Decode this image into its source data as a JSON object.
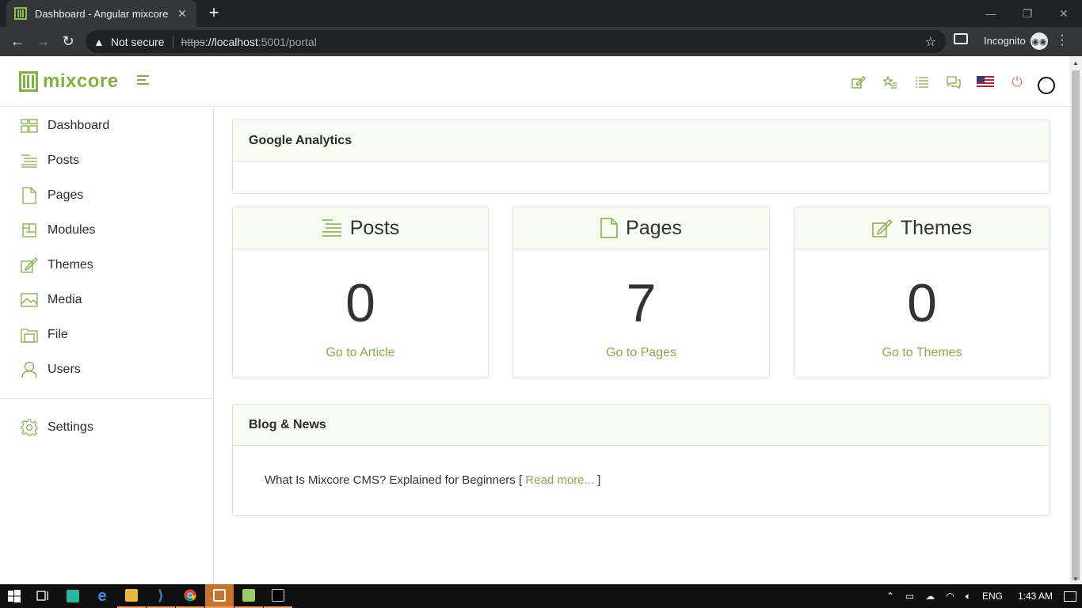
{
  "browser": {
    "tab_title": "Dashboard - Angular mixcore",
    "tab_close": "✕",
    "new_tab": "+",
    "security_label": "Not secure",
    "url_scheme": "https",
    "url_host": "://localhost",
    "url_path": ":5001/portal",
    "profile_label": "Incognito"
  },
  "header": {
    "logo_text": "mixcore",
    "icons": [
      "edit-icon",
      "star-list-icon",
      "list-icon",
      "messages-icon",
      "us-flag-icon",
      "power-icon",
      "user-avatar-icon"
    ]
  },
  "sidebar": {
    "items": [
      {
        "label": "Dashboard",
        "icon": "dashboard-icon"
      },
      {
        "label": "Posts",
        "icon": "posts-icon"
      },
      {
        "label": "Pages",
        "icon": "pages-icon"
      },
      {
        "label": "Modules",
        "icon": "modules-icon"
      },
      {
        "label": "Themes",
        "icon": "themes-icon"
      },
      {
        "label": "Media",
        "icon": "media-icon"
      },
      {
        "label": "File",
        "icon": "file-icon"
      },
      {
        "label": "Users",
        "icon": "users-icon"
      }
    ],
    "settings_label": "Settings"
  },
  "main": {
    "analytics_title": "Google Analytics",
    "cards": [
      {
        "title": "Posts",
        "count": "0",
        "link": "Go to Article"
      },
      {
        "title": "Pages",
        "count": "7",
        "link": "Go to Pages"
      },
      {
        "title": "Themes",
        "count": "0",
        "link": "Go to Themes"
      }
    ],
    "news": {
      "title": "Blog & News",
      "item_text": "What Is Mixcore CMS? Explained for Beginners [ ",
      "item_link": "Read more...",
      "item_suffix": " ]"
    }
  },
  "taskbar": {
    "language": "ENG",
    "time": "1:43 AM"
  },
  "colors": {
    "accent": "#7eb142",
    "panel_header_bg": "#f7fbf1",
    "browser_dark": "#202124",
    "browser_toolbar": "#35363a"
  }
}
